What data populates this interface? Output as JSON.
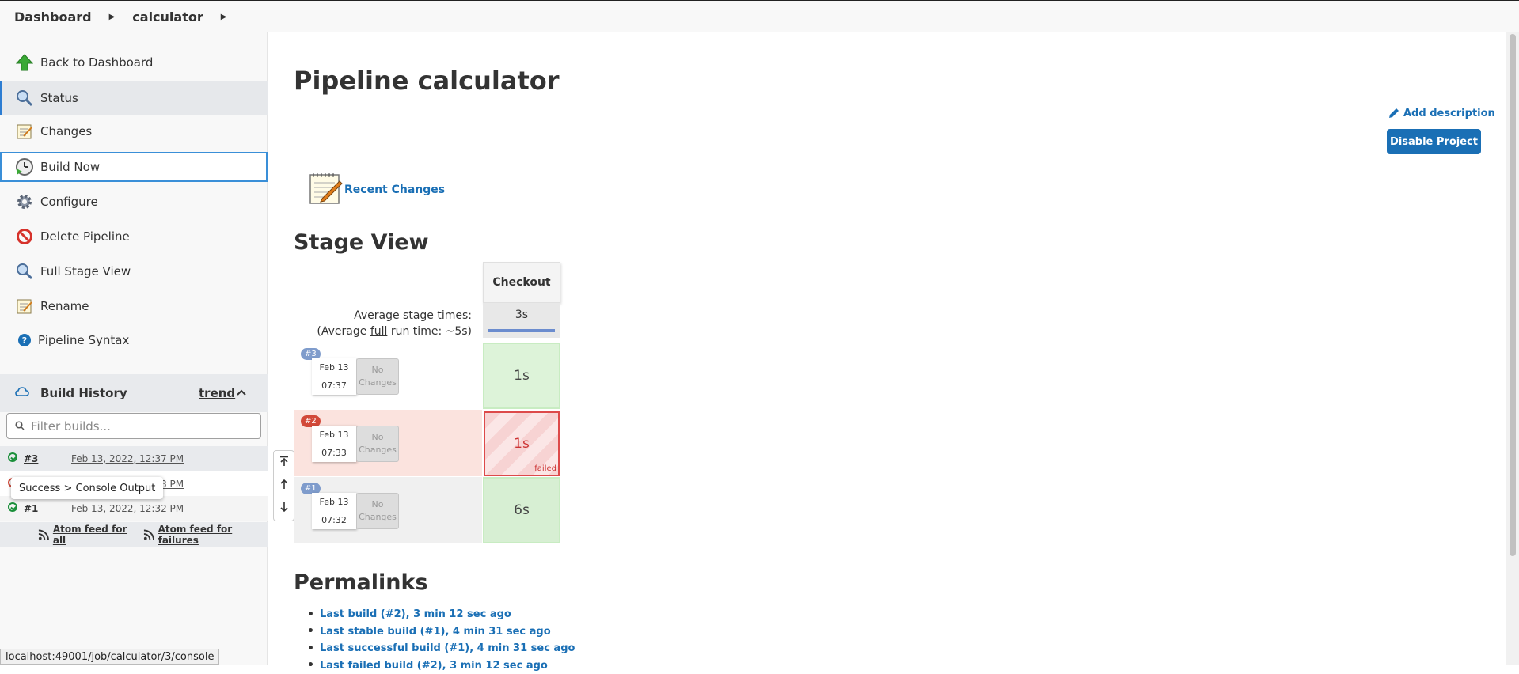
{
  "breadcrumb": {
    "items": [
      "Dashboard",
      "calculator"
    ]
  },
  "sidebar": {
    "items": [
      {
        "label": "Back to Dashboard",
        "icon": "arrow-up-icon"
      },
      {
        "label": "Status",
        "icon": "magnifier-icon"
      },
      {
        "label": "Changes",
        "icon": "notepad-icon"
      },
      {
        "label": "Build Now",
        "icon": "clock-play-icon"
      },
      {
        "label": "Configure",
        "icon": "gear-icon"
      },
      {
        "label": "Delete Pipeline",
        "icon": "no-entry-icon"
      },
      {
        "label": "Full Stage View",
        "icon": "magnifier-icon"
      },
      {
        "label": "Rename",
        "icon": "notepad-icon"
      },
      {
        "label": "Pipeline Syntax",
        "icon": "help-icon"
      }
    ],
    "build_history": {
      "title": "Build History",
      "trend_label": "trend",
      "filter_placeholder": "Filter builds...",
      "rows": [
        {
          "number": "#3",
          "date": "Feb 13, 2022, 12:37 PM",
          "status": "success"
        },
        {
          "number": "#2",
          "date": "Feb 13, 2022, 12:33 PM",
          "status": "failed"
        },
        {
          "number": "#1",
          "date": "Feb 13, 2022, 12:32 PM",
          "status": "success"
        }
      ],
      "tooltip": "Success > Console Output",
      "atom_all": "Atom feed for all",
      "atom_failures": "Atom feed for failures"
    }
  },
  "status_bar": "localhost:49001/job/calculator/3/console",
  "main": {
    "title": "Pipeline calculator",
    "add_description": "Add description",
    "disable_button": "Disable Project",
    "recent_changes": "Recent Changes",
    "stage_view": {
      "title": "Stage View",
      "stage_name": "Checkout",
      "avg_label": "Average stage times:",
      "avg_full_prefix": "(Average ",
      "avg_full_word": "full",
      "avg_full_suffix": " run time: ~5s)",
      "avg_time": "3s",
      "no_changes": "No Changes",
      "failed_label": "failed",
      "runs": [
        {
          "tag": "#3",
          "date": "Feb 13",
          "time": "07:37",
          "duration": "1s",
          "status": "success"
        },
        {
          "tag": "#2",
          "date": "Feb 13",
          "time": "07:33",
          "duration": "1s",
          "status": "failed"
        },
        {
          "tag": "#1",
          "date": "Feb 13",
          "time": "07:32",
          "duration": "6s",
          "status": "success"
        }
      ]
    },
    "permalinks": {
      "title": "Permalinks",
      "items": [
        "Last build (#2), 3 min 12 sec ago",
        "Last stable build (#1), 4 min 31 sec ago",
        "Last successful build (#1), 4 min 31 sec ago",
        "Last failed build (#2), 3 min 12 sec ago"
      ]
    }
  },
  "colors": {
    "accent": "#1a6fb5",
    "success": "#1a8f3a",
    "failure": "#d24939"
  }
}
